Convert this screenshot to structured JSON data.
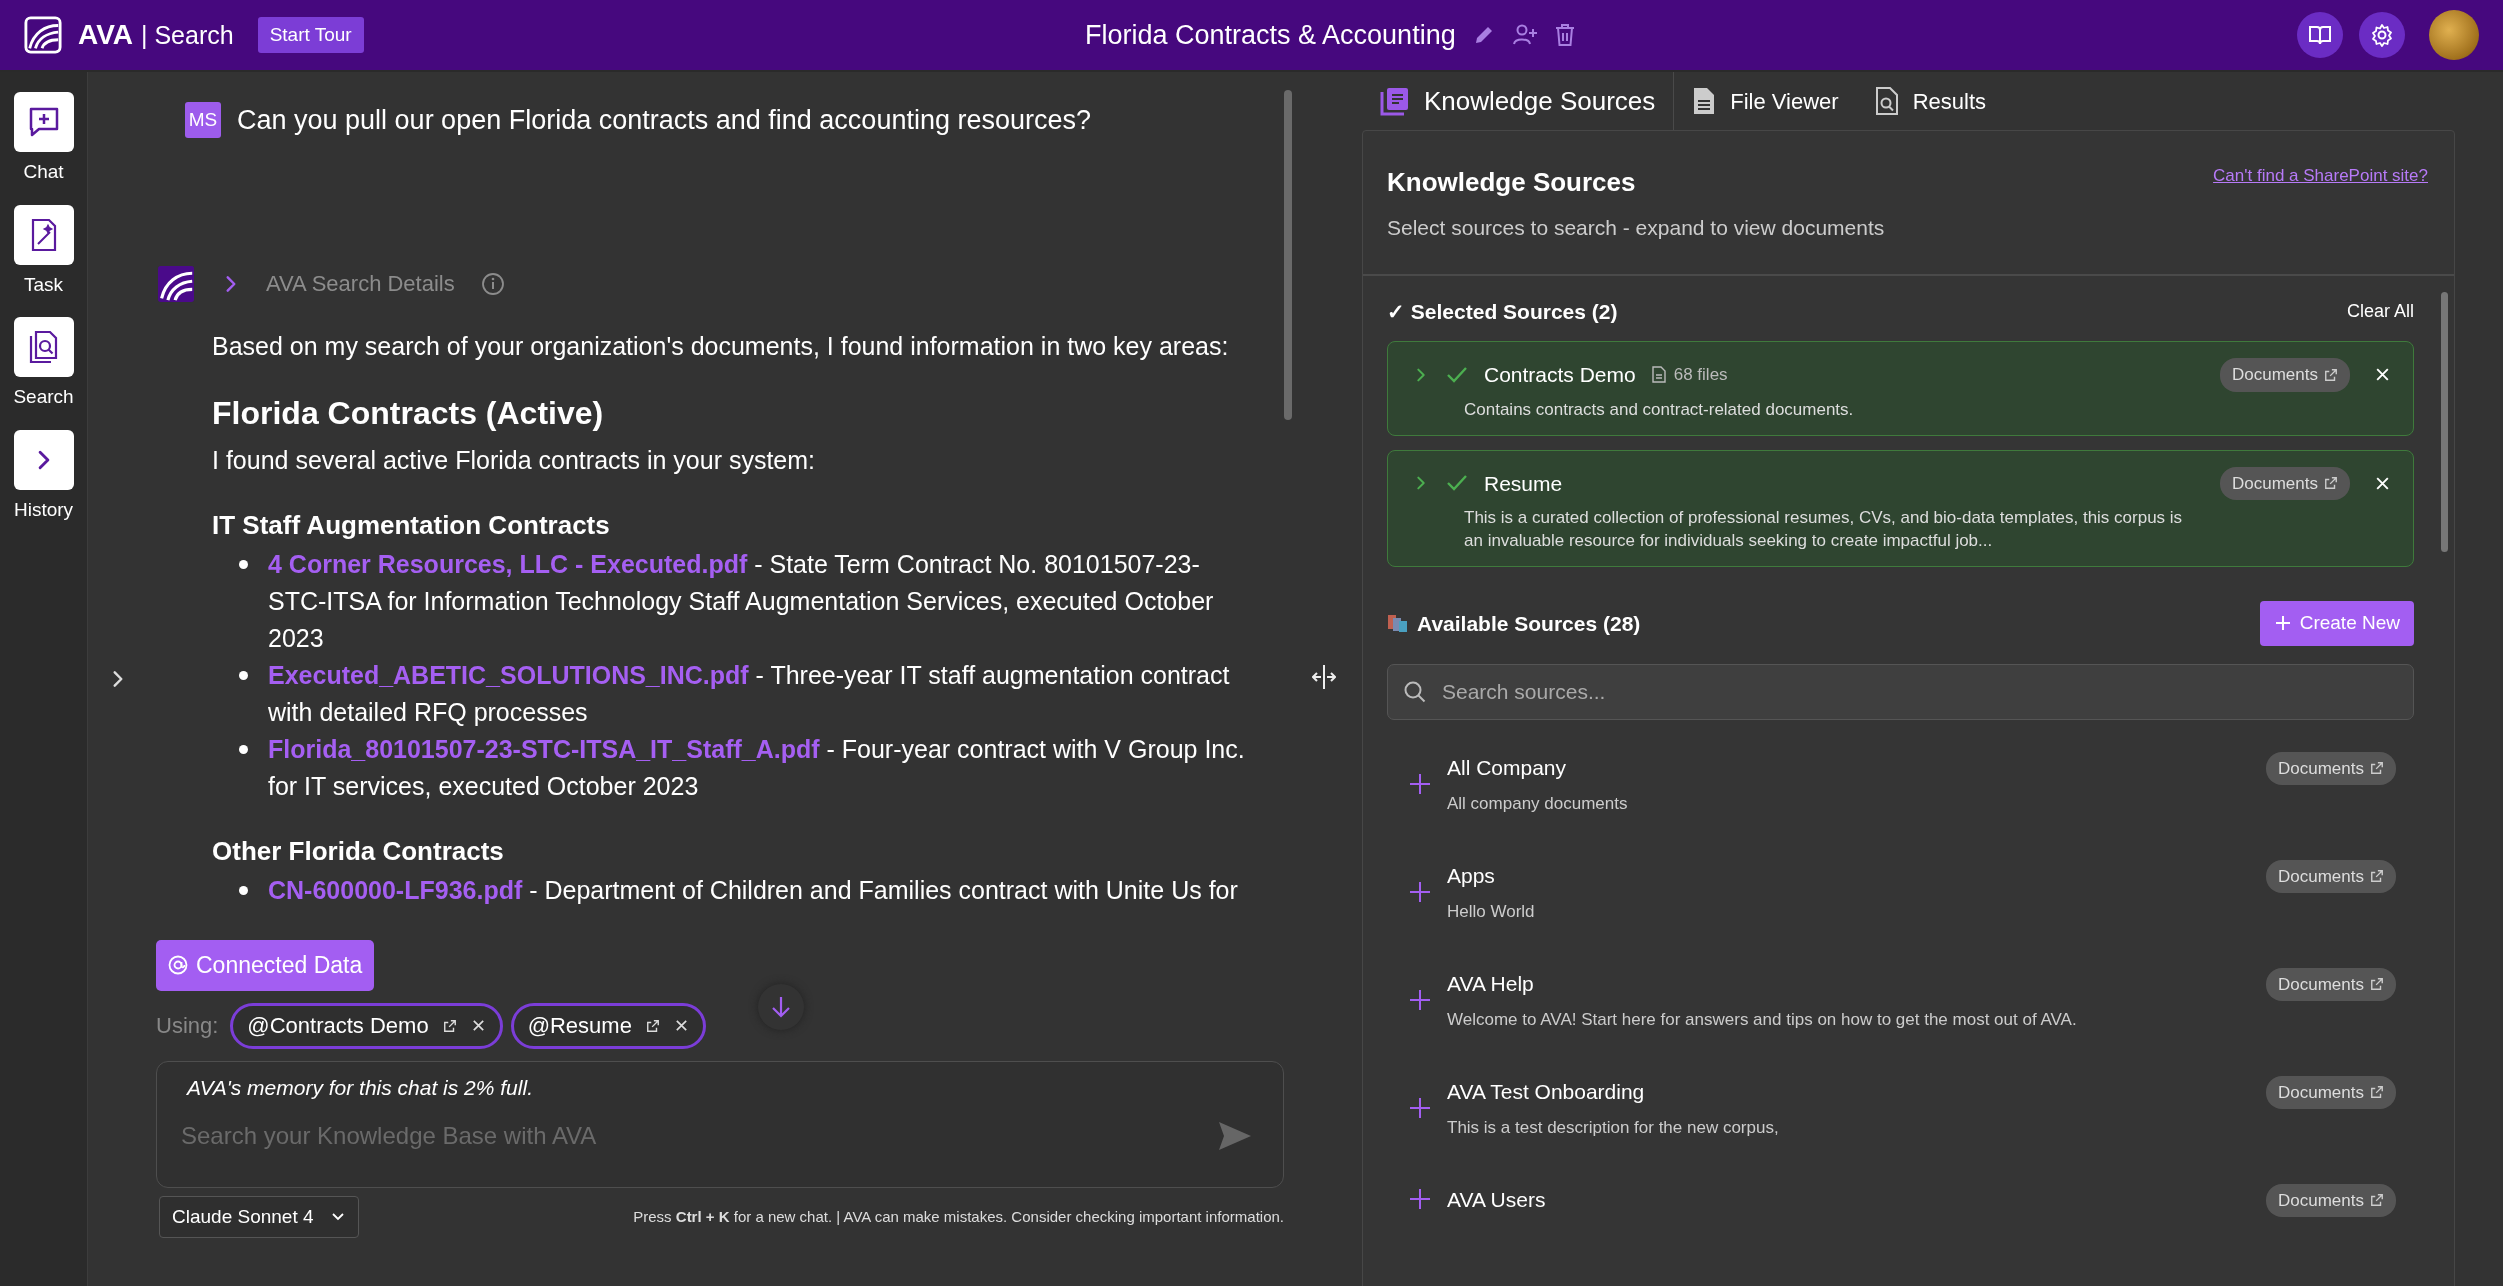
{
  "header": {
    "app": "AVA",
    "section": "| Search",
    "tour_button": "Start Tour",
    "title": "Florida Contracts & Accounting"
  },
  "rail": [
    {
      "kind": "chat",
      "label": "Chat"
    },
    {
      "kind": "task",
      "label": "Task"
    },
    {
      "kind": "search",
      "label": "Search"
    },
    {
      "kind": "history",
      "label": "History"
    }
  ],
  "chat": {
    "user_initials": "MS",
    "user_message": "Can you pull our open Florida contracts and find accounting resources?",
    "details_label": "AVA Search Details",
    "answer": [
      {
        "kind": "paragraph",
        "text": "Based on my search of your organization's documents, I found information in two key areas:"
      },
      {
        "kind": "heading",
        "text": "Florida Contracts (Active)"
      },
      {
        "kind": "paragraph",
        "text": "I found several active Florida contracts in your system:"
      },
      {
        "kind": "subheading",
        "text": "IT Staff Augmentation Contracts"
      },
      {
        "kind": "bullet",
        "link": "4 Corner Resources, LLC - Executed.pdf",
        "text": " - State Term Contract No. 80101507-23-STC-ITSA for Information Technology Staff Augmentation Services, executed October 2023"
      },
      {
        "kind": "bullet",
        "link": "Executed_ABETIC_SOLUTIONS_INC.pdf",
        "text": " - Three-year IT staff augmentation contract with detailed RFQ processes"
      },
      {
        "kind": "bullet",
        "link": "Florida_80101507-23-STC-ITSA_IT_Staff_A.pdf",
        "text": " - Four-year contract with V Group Inc. for IT services, executed October 2023"
      },
      {
        "kind": "subheading",
        "text": "Other Florida Contracts"
      },
      {
        "kind": "bullet",
        "link": "CN-600000-LF936.pdf",
        "text": " - Department of Children and Families contract with Unite Us for"
      }
    ]
  },
  "composer": {
    "connected_button": "Connected Data",
    "using_label": "Using:",
    "chips": [
      "@Contracts Demo",
      "@Resume"
    ],
    "memory_note": "AVA's memory for this chat is 2% full.",
    "input": {
      "placeholder": "Search your Knowledge Base with AVA"
    },
    "model": "Claude Sonnet 4",
    "footer_note": "Press **Ctrl + K** for a new chat. | AVA can make mistakes. Consider checking important information."
  },
  "panel": {
    "tabs": [
      {
        "kind": "sources",
        "label": "Knowledge Sources",
        "selected": true
      },
      {
        "kind": "file",
        "label": "File Viewer",
        "selected": false
      },
      {
        "kind": "results",
        "label": "Results",
        "selected": false
      }
    ],
    "title": "Knowledge Sources",
    "subtitle": "Select sources to search - expand to view documents",
    "sharepoint_link": "Can't find a SharePoint site?",
    "selected_heading": "✓ Selected Sources (2)",
    "clear_all": "Clear All",
    "selected_sources": [
      {
        "name": "Contracts Demo",
        "files": "68 files",
        "description": "Contains contracts and contract-related documents.",
        "badge": "Documents"
      },
      {
        "name": "Resume",
        "description": "This is a curated collection of professional resumes, CVs, and bio-data templates, this corpus is an invaluable resource for individuals seeking to create impactful job...",
        "badge": "Documents"
      }
    ],
    "available_heading": "Available Sources (28)",
    "create_button": "Create New",
    "search": {
      "placeholder": "Search sources..."
    },
    "available_sources": [
      {
        "name": "All Company",
        "description": "All company documents",
        "badge": "Documents"
      },
      {
        "name": "Apps",
        "description": "Hello World",
        "badge": "Documents"
      },
      {
        "name": "AVA Help",
        "description": "Welcome to AVA! Start here for answers and tips on how to get the most out of AVA.",
        "badge": "Documents"
      },
      {
        "name": "AVA Test Onboarding",
        "description": "This is a test description for the new corpus,",
        "badge": "Documents"
      },
      {
        "name": "AVA Users",
        "badge": "Documents"
      }
    ]
  }
}
